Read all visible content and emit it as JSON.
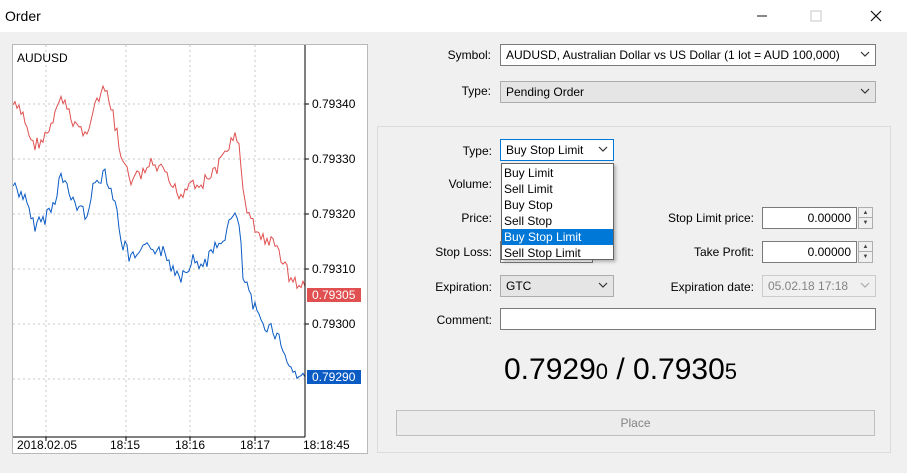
{
  "window": {
    "title": "Order",
    "min_icon": "minimize-icon",
    "max_icon": "maximize-icon",
    "close_icon": "close-icon"
  },
  "chart": {
    "symbol": "AUDUSD",
    "price_ticks": [
      "0.79340",
      "0.79330",
      "0.79320",
      "0.79310",
      "0.79300"
    ],
    "ask_label": "0.79305",
    "bid_label": "0.79290",
    "time_ticks": [
      "2018.02.05",
      "18:15",
      "18:16",
      "18:17"
    ],
    "current_time": "18:18:45",
    "colors": {
      "ask": "#e05050",
      "bid": "#0a5bc4"
    }
  },
  "form": {
    "symbol_label": "Symbol:",
    "symbol_value": "AUDUSD, Australian Dollar vs US Dollar (1 lot = AUD 100,000)",
    "type_label": "Type:",
    "type_value": "Pending Order",
    "pending_type_label": "Type:",
    "pending_type_value": "Buy Stop Limit",
    "pending_type_options": [
      "Buy Limit",
      "Sell Limit",
      "Buy Stop",
      "Sell Stop",
      "Buy Stop Limit",
      "Sell Stop Limit"
    ],
    "volume_label": "Volume:",
    "price_label": "Price:",
    "stop_limit_label": "Stop Limit price:",
    "stop_limit_value": "0.00000",
    "stop_loss_label": "Stop Loss:",
    "take_profit_label": "Take Profit:",
    "take_profit_value": "0.00000",
    "expiration_label": "Expiration:",
    "expiration_value": "GTC",
    "expiration_date_label": "Expiration date:",
    "expiration_date_value": "05.02.18 17:18",
    "comment_label": "Comment:",
    "comment_value": "",
    "bid_main": "0.7929",
    "bid_small": "0",
    "separator": " / ",
    "ask_main": "0.7930",
    "ask_small": "5",
    "place_label": "Place"
  }
}
